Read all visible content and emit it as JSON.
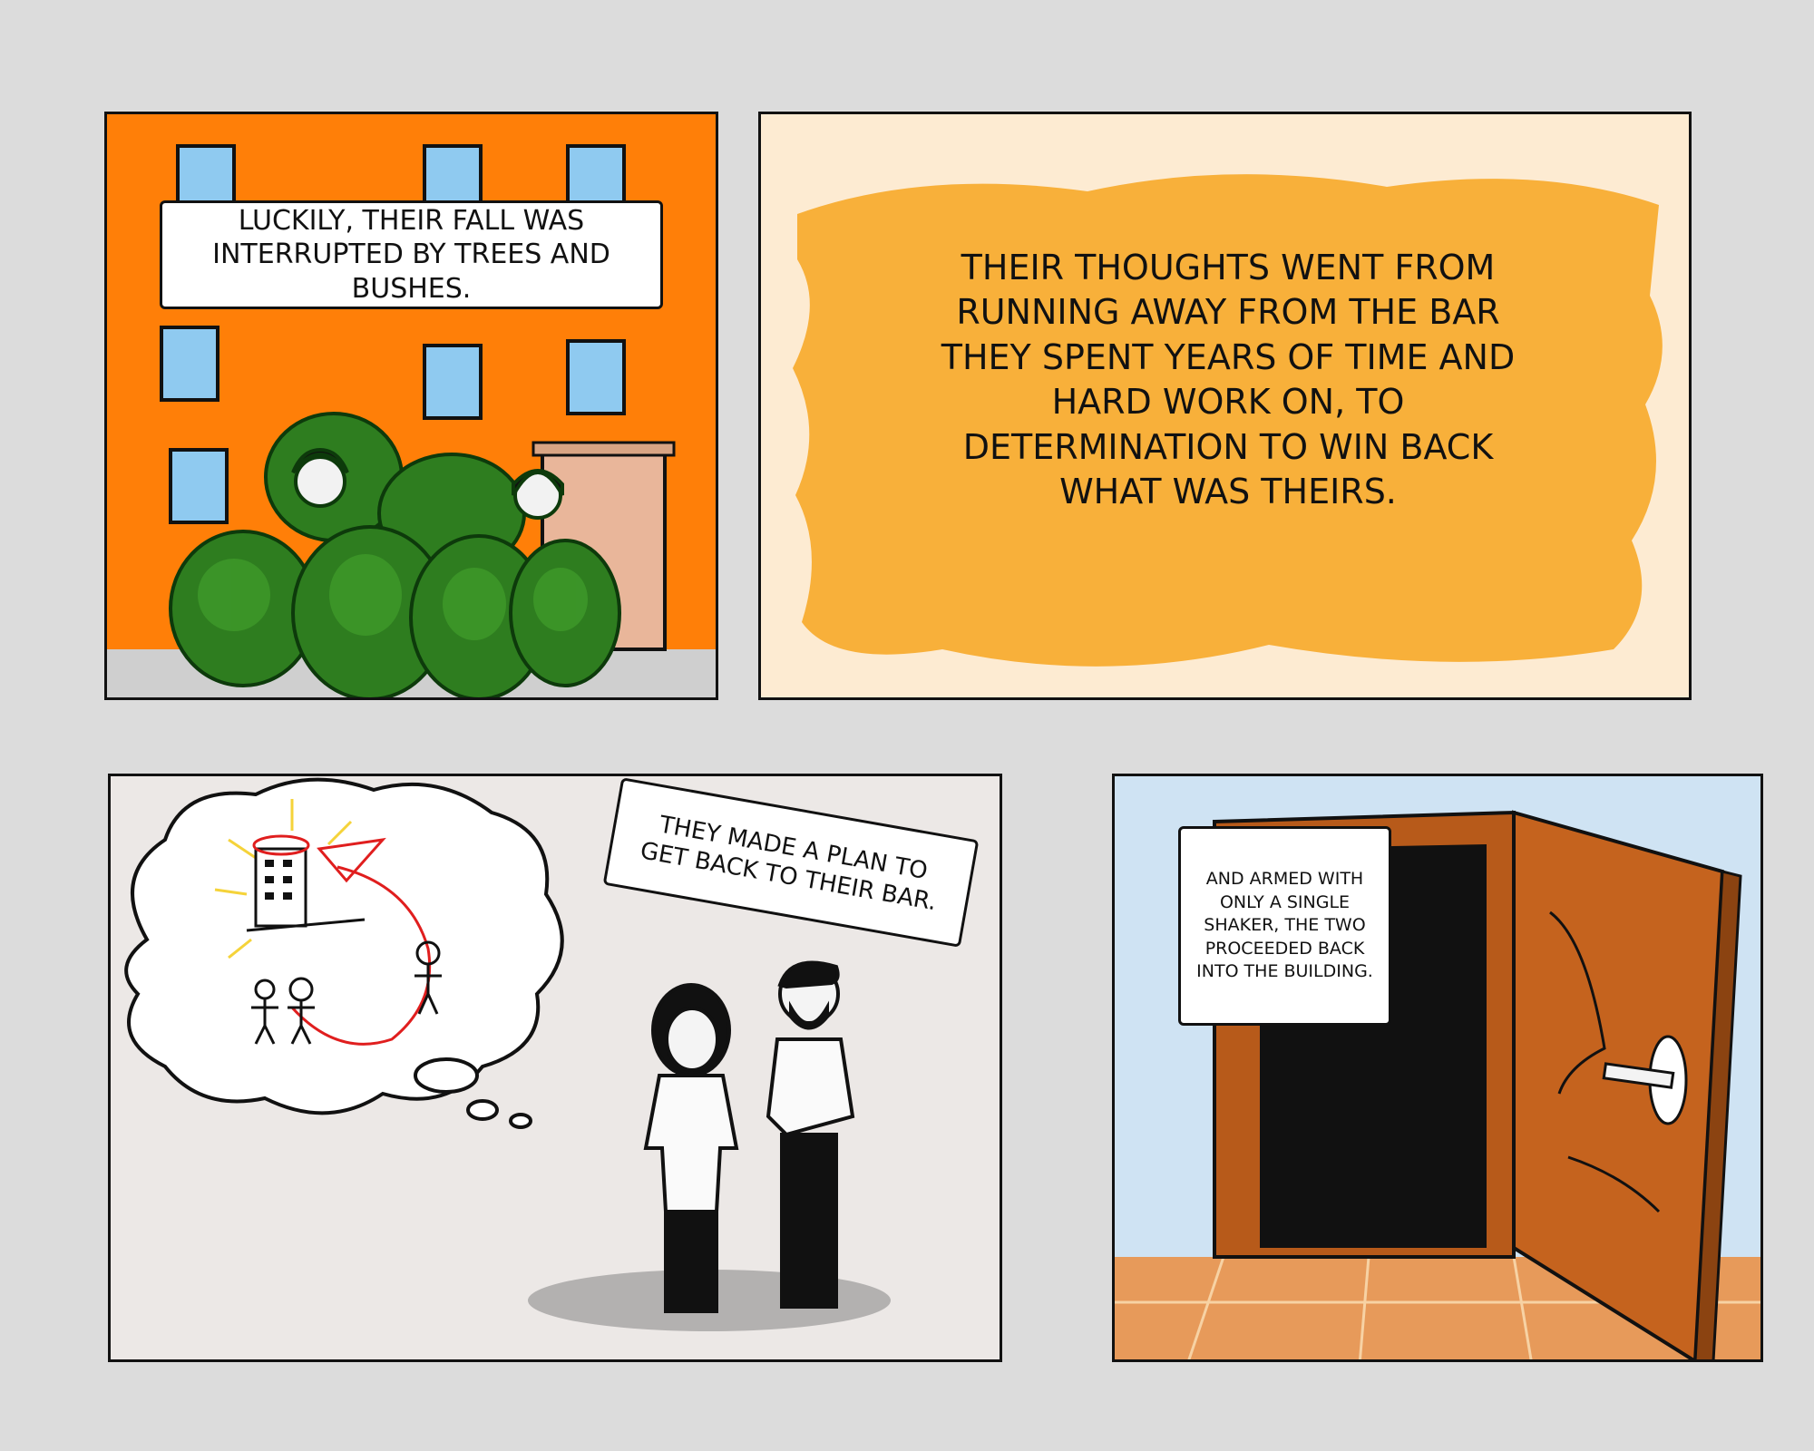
{
  "page": {
    "background_color": "#dcdcdc"
  },
  "panels": [
    {
      "caption": "LUCKILY, THEIR FALL WAS INTERRUPTED BY TREES AND BUSHES.",
      "colors": {
        "wall": "#ff7f08",
        "window": "#8fcaf0",
        "bush": "#2e7d1f",
        "ground": "#cfcfcf"
      }
    },
    {
      "caption": "THEIR THOUGHTS WENT FROM RUNNING AWAY FROM THE BAR THEY SPENT YEARS OF TIME AND HARD WORK ON, TO DETERMINATION TO WIN BACK WHAT WAS THEIRS.",
      "colors": {
        "background": "#fdebd2",
        "brush": "#f8b03a"
      }
    },
    {
      "caption": "THEY MADE A PLAN TO GET BACK TO THEIR BAR.",
      "colors": {
        "background": "#ece8e6",
        "plan_arrow": "#e01e1e",
        "glow": "#f5d33a"
      }
    },
    {
      "caption": "AND ARMED WITH ONLY A SINGLE SHAKER, THE TWO PROCEEDED BACK INTO THE BUILDING.",
      "colors": {
        "wall": "#cfe3f3",
        "door": "#c5631e",
        "floor": "#e79a5a"
      }
    }
  ]
}
